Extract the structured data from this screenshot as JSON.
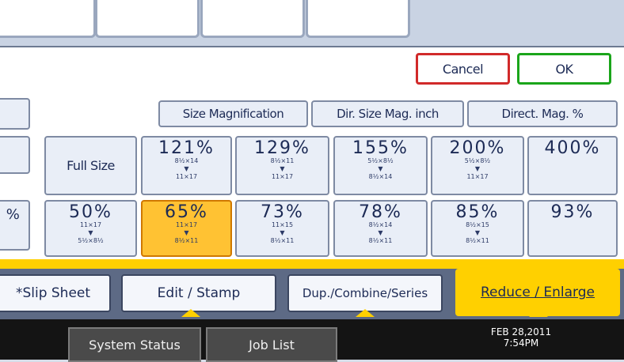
{
  "dialog": {
    "cancel_label": "Cancel",
    "ok_label": "OK"
  },
  "selector_buttons": {
    "size_magnification": "Size Magnification",
    "dir_size_mag_inch": "Dir. Size Mag. inch",
    "direct_mag_pct": "Direct. Mag. %"
  },
  "full_size_label": "Full Size",
  "row1_left_fragment": "",
  "row2_left_fragment": "%",
  "ratios_row1": [
    {
      "pct": "121%",
      "from": "8½×14",
      "to": "11×17"
    },
    {
      "pct": "129%",
      "from": "8½×11",
      "to": "11×17"
    },
    {
      "pct": "155%",
      "from": "5½×8½",
      "to": "8½×14"
    },
    {
      "pct": "200%",
      "from": "5½×8½",
      "to": "11×17"
    },
    {
      "pct": "400%",
      "from": "",
      "to": ""
    }
  ],
  "ratios_row2": [
    {
      "pct": "50%",
      "from": "11×17",
      "to": "5½×8½"
    },
    {
      "pct": "65%",
      "from": "11×17",
      "to": "8½×11",
      "selected": true
    },
    {
      "pct": "73%",
      "from": "11×15",
      "to": "8½×11"
    },
    {
      "pct": "78%",
      "from": "8½×14",
      "to": "8½×11"
    },
    {
      "pct": "85%",
      "from": "8½×15",
      "to": "8½×11"
    },
    {
      "pct": "93%",
      "from": "",
      "to": ""
    }
  ],
  "function_tabs": [
    {
      "label": "*Slip Sheet"
    },
    {
      "label": "Edit / Stamp"
    },
    {
      "label": "Dup./Combine/Series"
    },
    {
      "label": "Reduce / Enlarge",
      "active": true
    }
  ],
  "status": {
    "system_status": "System Status",
    "job_list": "Job List",
    "date": "FEB  28,2011",
    "time": "7:54PM"
  },
  "colors": {
    "accent": "#ffd000",
    "selected": "#ffc233",
    "cancel_border": "#d12a2a",
    "ok_border": "#1aa51a"
  }
}
